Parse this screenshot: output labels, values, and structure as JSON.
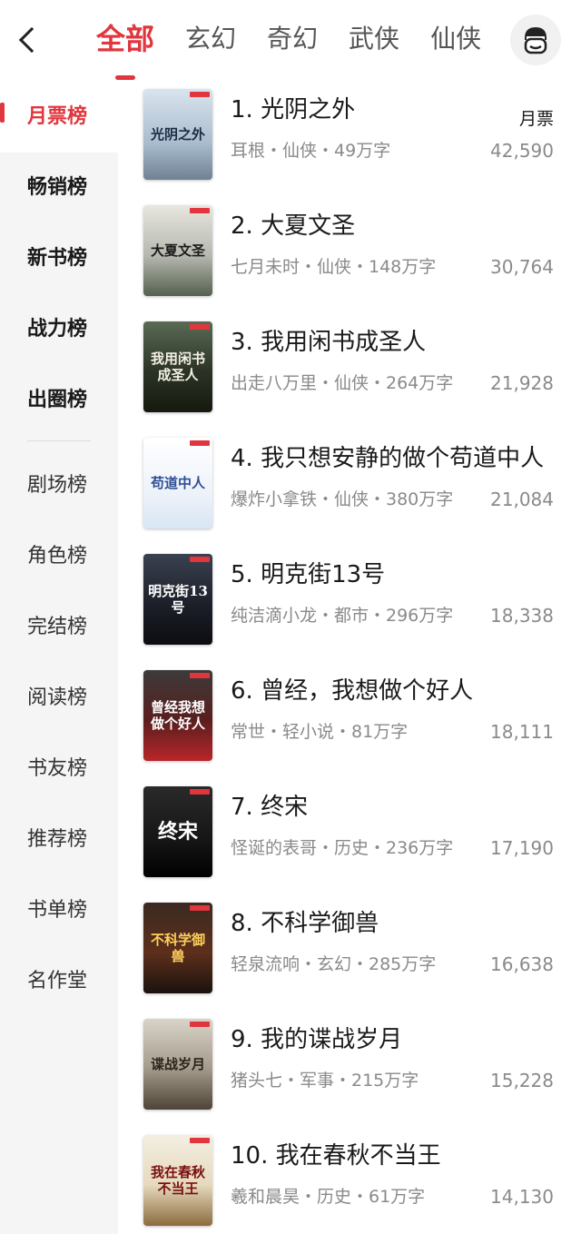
{
  "nav": {
    "tabs": [
      {
        "label": "全部",
        "active": true
      },
      {
        "label": "玄幻"
      },
      {
        "label": "奇幻"
      },
      {
        "label": "武侠"
      },
      {
        "label": "仙侠"
      }
    ]
  },
  "sidebar": {
    "items": [
      {
        "label": "月票榜"
      },
      {
        "label": "畅销榜"
      },
      {
        "label": "新书榜"
      },
      {
        "label": "战力榜"
      },
      {
        "label": "出圈榜"
      },
      {
        "label": "剧场榜"
      },
      {
        "label": "角色榜"
      },
      {
        "label": "完结榜"
      },
      {
        "label": "阅读榜"
      },
      {
        "label": "书友榜"
      },
      {
        "label": "推荐榜"
      },
      {
        "label": "书单榜"
      },
      {
        "label": "名作堂"
      }
    ]
  },
  "list": {
    "ticket_label": "月票",
    "books": [
      {
        "title": "1. 光阴之外",
        "meta": "耳根・仙侠・49万字",
        "count": "42,590",
        "cover_text": "光阴之外"
      },
      {
        "title": "2. 大夏文圣",
        "meta": "七月未时・仙侠・148万字",
        "count": "30,764",
        "cover_text": "大夏文圣"
      },
      {
        "title": "3. 我用闲书成圣人",
        "meta": "出走八万里・仙侠・264万字",
        "count": "21,928",
        "cover_text": "我用闲书成圣人"
      },
      {
        "title": "4. 我只想安静的做个苟道中人",
        "meta": "爆炸小拿铁・仙侠・380万字",
        "count": "21,084",
        "cover_text": "苟道中人"
      },
      {
        "title": "5. 明克街13号",
        "meta": "纯洁滴小龙・都市・296万字",
        "count": "18,338",
        "cover_text": "明克街13号"
      },
      {
        "title": "6. 曾经，我想做个好人",
        "meta": "常世・轻小说・81万字",
        "count": "18,111",
        "cover_text": "曾经我想做个好人"
      },
      {
        "title": "7. 终宋",
        "meta": "怪诞的表哥・历史・236万字",
        "count": "17,190",
        "cover_text": "终宋"
      },
      {
        "title": "8. 不科学御兽",
        "meta": "轻泉流响・玄幻・285万字",
        "count": "16,638",
        "cover_text": "不科学御兽"
      },
      {
        "title": "9. 我的谍战岁月",
        "meta": "猪头七・军事・215万字",
        "count": "15,228",
        "cover_text": "谍战岁月"
      },
      {
        "title": "10. 我在春秋不当王",
        "meta": "羲和晨昊・历史・61万字",
        "count": "14,130",
        "cover_text": "我在春秋不当王"
      }
    ]
  }
}
